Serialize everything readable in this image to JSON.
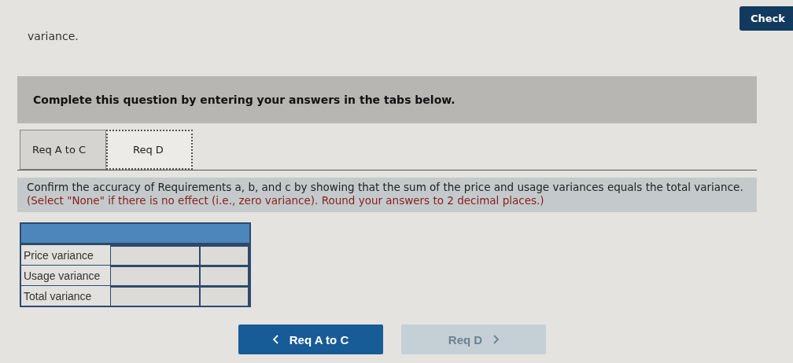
{
  "intro_text": "variance.",
  "check_button": {
    "label": "Check"
  },
  "banner": "Complete this question by entering your answers in the tabs below.",
  "tabs": [
    {
      "label": "Req A to C",
      "selected": false
    },
    {
      "label": "Req D",
      "selected": true
    }
  ],
  "instruction": {
    "text": "Confirm the accuracy of Requirements a, b, and c by showing that the sum of the price and usage variances equals the total variance.",
    "note": "(Select \"None\" if there is no effect (i.e., zero variance). Round your answers to 2 decimal places.)"
  },
  "table": {
    "rows": [
      {
        "label": "Price variance"
      },
      {
        "label": "Usage variance"
      },
      {
        "label": "Total variance"
      }
    ]
  },
  "nav": [
    {
      "label": "Req A to C",
      "kind": "prev",
      "disabled": false
    },
    {
      "label": "Req D",
      "kind": "next",
      "disabled": true
    }
  ]
}
